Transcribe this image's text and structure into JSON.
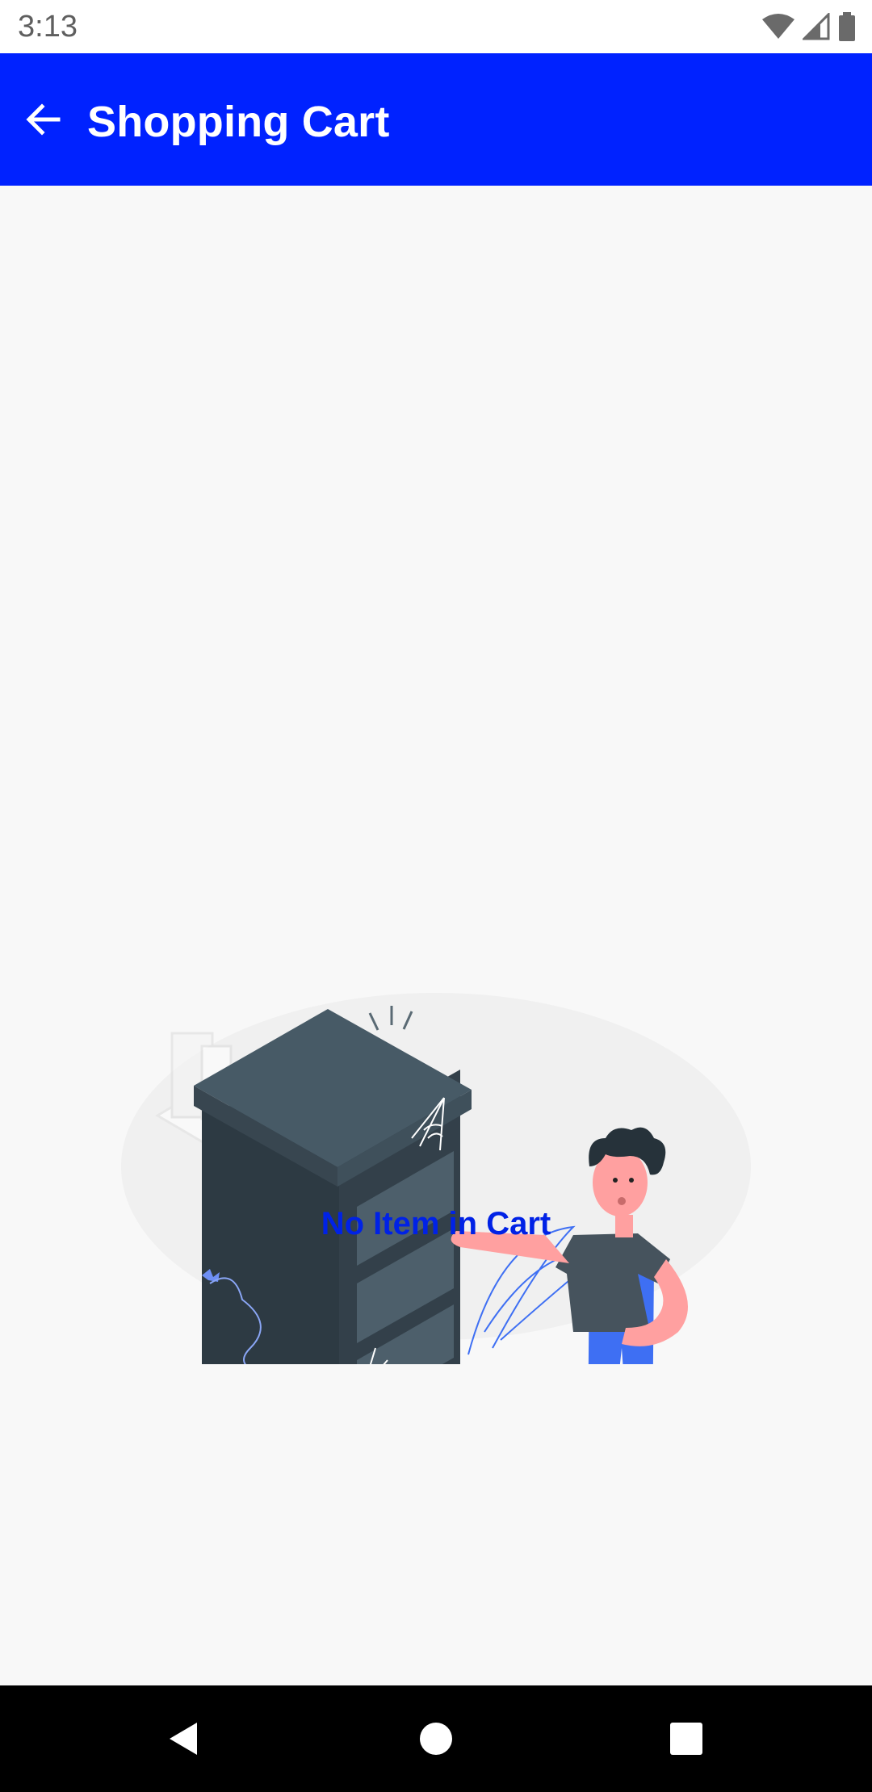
{
  "status_bar": {
    "time": "3:13",
    "icons": [
      "wifi-icon",
      "cell-signal-icon",
      "battery-icon"
    ]
  },
  "app_bar": {
    "title": "Shopping Cart",
    "back_icon": "arrow-back-icon",
    "background_color": "#0022ff"
  },
  "empty_state": {
    "message": "No Item in Cart",
    "message_color": "#0022e6",
    "illustration": "empty-cart-illustration"
  },
  "nav_bar": {
    "buttons": [
      "back-triangle-icon",
      "home-circle-icon",
      "recents-square-icon"
    ]
  }
}
